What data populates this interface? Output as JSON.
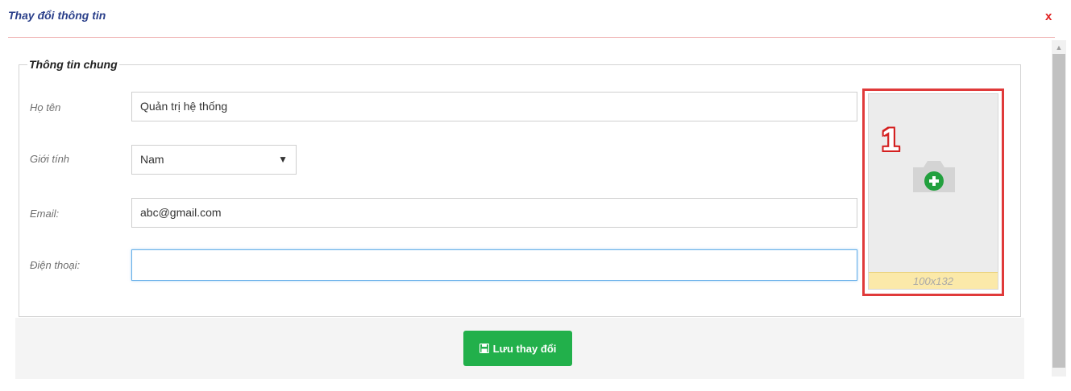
{
  "dialog": {
    "title": "Thay đổi thông tin",
    "close_label": "x"
  },
  "fieldset": {
    "legend": "Thông tin chung"
  },
  "form": {
    "name": {
      "label": "Họ tên",
      "value": "Quản trị hệ thống"
    },
    "gender": {
      "label": "Giới tính",
      "selected": "Nam"
    },
    "email": {
      "label": "Email:",
      "value": "abc@gmail.com"
    },
    "phone": {
      "label": "Điện thoại:",
      "value": ""
    }
  },
  "photo": {
    "step_number": "1",
    "size_caption": "100x132",
    "icon": "camera-add-icon"
  },
  "footer": {
    "save_label": "Lưu thay đổi",
    "save_icon": "floppy-disk-icon"
  },
  "colors": {
    "title": "#2a3f8a",
    "close": "#e02020",
    "save_button": "#22b04b",
    "highlight": "#e03a3a",
    "caption_bg": "#fbe9a9"
  }
}
